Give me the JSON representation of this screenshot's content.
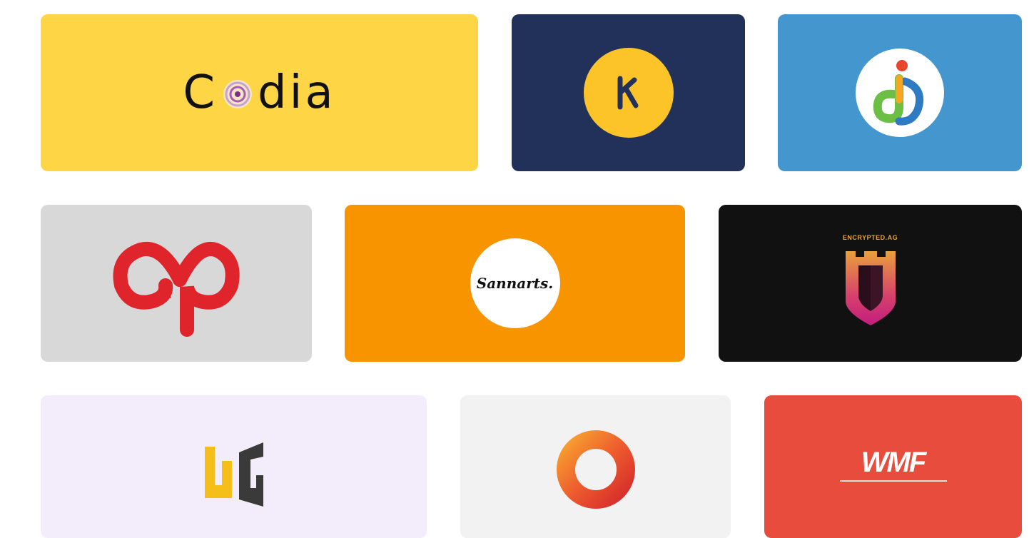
{
  "logos": [
    {
      "id": "codia",
      "text_before": "C",
      "text_after": "dia",
      "bg": "#FDD545"
    },
    {
      "id": "k-brand",
      "letter": "K",
      "bg": "#22315A",
      "accent": "#FDC42A"
    },
    {
      "id": "dj-brand",
      "bg": "#4496CE"
    },
    {
      "id": "ap-brand",
      "bg": "#D8D8D8",
      "accent": "#E0242B"
    },
    {
      "id": "sannarts",
      "text": "Sannarts.",
      "bg": "#F79400"
    },
    {
      "id": "encrypted",
      "text": "ENCRYPTED.AG",
      "bg": "#111111"
    },
    {
      "id": "wg-brand",
      "bg": "#F3ECFB"
    },
    {
      "id": "ring-brand",
      "bg": "#F2F2F2"
    },
    {
      "id": "wmf",
      "text": "WMF",
      "bg": "#E74C3C"
    }
  ]
}
